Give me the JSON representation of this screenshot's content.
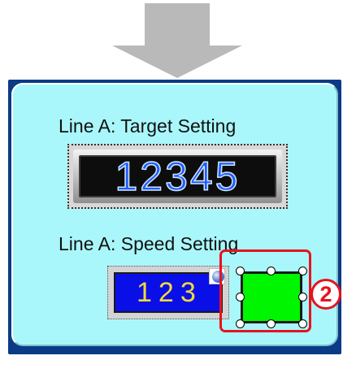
{
  "icons": {
    "step_arrow": "down-arrow-icon",
    "speed_badge": "blue-ball-icon"
  },
  "colors": {
    "callout": "#e8121e",
    "panel_background": "#a9f7fb",
    "panel_border": "#0b3a86",
    "target_digits": "#1f5dff",
    "speed_screen": "#0a0fe8",
    "speed_digits": "#f2d93a",
    "switch_fill": "#00f500"
  },
  "panel": {
    "target_label": "Line A: Target Setting",
    "target_value": "12345",
    "speed_label": "Line A: Speed Setting",
    "speed_value": "123"
  },
  "callout": {
    "number": "2"
  }
}
